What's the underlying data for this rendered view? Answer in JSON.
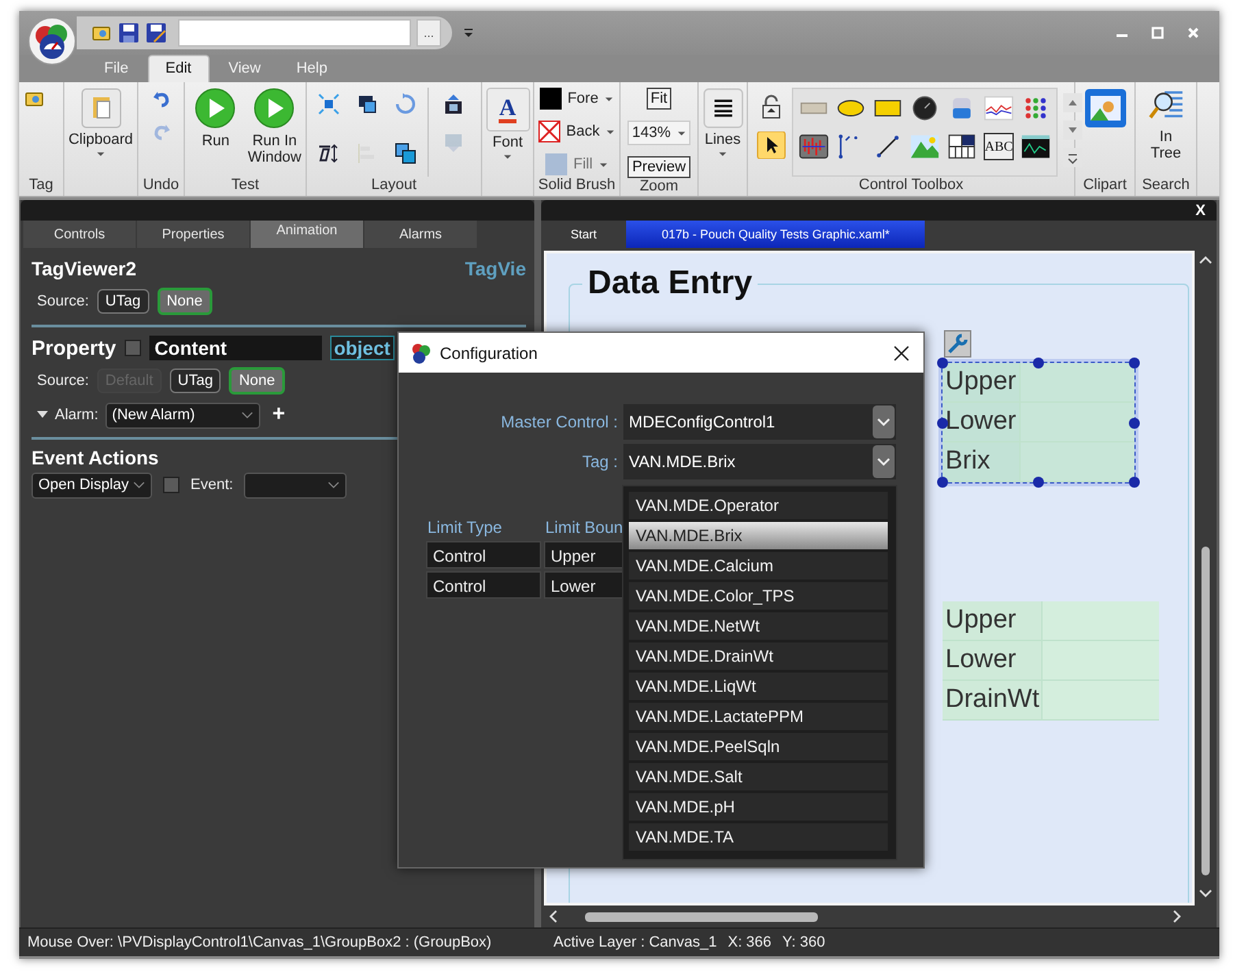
{
  "quick_access": {
    "more_button": "..."
  },
  "menu_tabs": [
    {
      "label": "File",
      "selected": false
    },
    {
      "label": "Edit",
      "selected": true
    },
    {
      "label": "View",
      "selected": false
    },
    {
      "label": "Help",
      "selected": false
    }
  ],
  "ribbon": {
    "tag": {
      "label": "Tag"
    },
    "clipboard": {
      "button": "Clipboard"
    },
    "undo": {
      "label": "Undo",
      "redo_disabled": true
    },
    "test": {
      "label": "Test",
      "buttons": [
        "Run",
        "Run In Window"
      ]
    },
    "layout": {
      "label": "Layout"
    },
    "font": {
      "glyph": "A",
      "button": "Font"
    },
    "solid_brush": {
      "label": "Solid Brush",
      "items": [
        {
          "kind": "swatch",
          "label": "Fore",
          "color": "#000000",
          "disabled": false
        },
        {
          "kind": "none",
          "label": "Back",
          "disabled": false
        },
        {
          "kind": "swatch",
          "label": "Fill",
          "color": "#a9bcd6",
          "disabled": true
        }
      ]
    },
    "zoom": {
      "label": "Zoom",
      "fit": "Fit",
      "value": "143%",
      "preview": "Preview"
    },
    "lines": {
      "button": "Lines"
    },
    "toolbox": {
      "label": "Control Toolbox",
      "text_glyph": "ABC"
    },
    "clipart": {
      "label": "Clipart"
    },
    "search": {
      "label": "Search",
      "button": "In Tree"
    }
  },
  "left_panel": {
    "tabs": [
      {
        "label": "Controls",
        "selected": false
      },
      {
        "label": "Properties",
        "selected": false
      },
      {
        "label": "Animation",
        "selected": true
      },
      {
        "label": "Alarms",
        "selected": false
      }
    ],
    "object_name": "TagViewer2",
    "object_type": "TagVie",
    "source": {
      "label": "Source:",
      "buttons": [
        {
          "label": "UTag",
          "selected": false,
          "disabled": false
        },
        {
          "label": "None",
          "selected": true,
          "disabled": false
        }
      ]
    },
    "property": {
      "label": "Property",
      "checked": false,
      "name": "Content",
      "type": "object"
    },
    "property_source": {
      "label": "Source:",
      "buttons": [
        {
          "label": "Default",
          "selected": false,
          "disabled": true
        },
        {
          "label": "UTag",
          "selected": false,
          "disabled": false
        },
        {
          "label": "None",
          "selected": true,
          "disabled": false
        }
      ]
    },
    "alarm": {
      "label": "Alarm:",
      "value": "(New Alarm)",
      "add": "+"
    },
    "event_actions": {
      "title": "Event Actions",
      "action": "Open Display",
      "event_checked": false,
      "event_label": "Event:"
    }
  },
  "document": {
    "close": "X",
    "tabs": [
      {
        "label": "Start",
        "selected": false
      },
      {
        "label": "017b - Pouch Quality Tests Graphic.xaml*",
        "selected": true
      }
    ],
    "canvas": {
      "title": "Data Entry",
      "groups": [
        {
          "rows": [
            "Upper",
            "Lower",
            "Brix"
          ],
          "selected": true
        },
        {
          "rows": [
            "Upper",
            "Lower",
            "DrainWt"
          ],
          "selected": false
        }
      ]
    }
  },
  "dialog": {
    "title": "Configuration",
    "master_label": "Master Control :",
    "master_value": "MDEConfigControl1",
    "tag_label": "Tag :",
    "tag_value": "VAN.MDE.Brix",
    "columns": [
      "Limit Type",
      "Limit Boun"
    ],
    "rows": [
      [
        "Control",
        "Upper"
      ],
      [
        "Control",
        "Lower"
      ]
    ],
    "dropdown": [
      {
        "label": "VAN.MDE.Operator",
        "selected": false
      },
      {
        "label": "VAN.MDE.Brix",
        "selected": true
      },
      {
        "label": "VAN.MDE.Calcium",
        "selected": false
      },
      {
        "label": "VAN.MDE.Color_TPS",
        "selected": false
      },
      {
        "label": "VAN.MDE.NetWt",
        "selected": false
      },
      {
        "label": "VAN.MDE.DrainWt",
        "selected": false
      },
      {
        "label": "VAN.MDE.LiqWt",
        "selected": false
      },
      {
        "label": "VAN.MDE.LactatePPM",
        "selected": false
      },
      {
        "label": "VAN.MDE.PeelSqln",
        "selected": false
      },
      {
        "label": "VAN.MDE.Salt",
        "selected": false
      },
      {
        "label": "VAN.MDE.pH",
        "selected": false
      },
      {
        "label": "VAN.MDE.TA",
        "selected": false
      }
    ]
  },
  "status_bar": {
    "mouse_over": "Mouse Over: \\PVDisplayControl1\\Canvas_1\\GroupBox2 : (GroupBox)",
    "active_layer": "Active Layer : Canvas_1",
    "x": "X: 366",
    "y": "Y: 360"
  }
}
